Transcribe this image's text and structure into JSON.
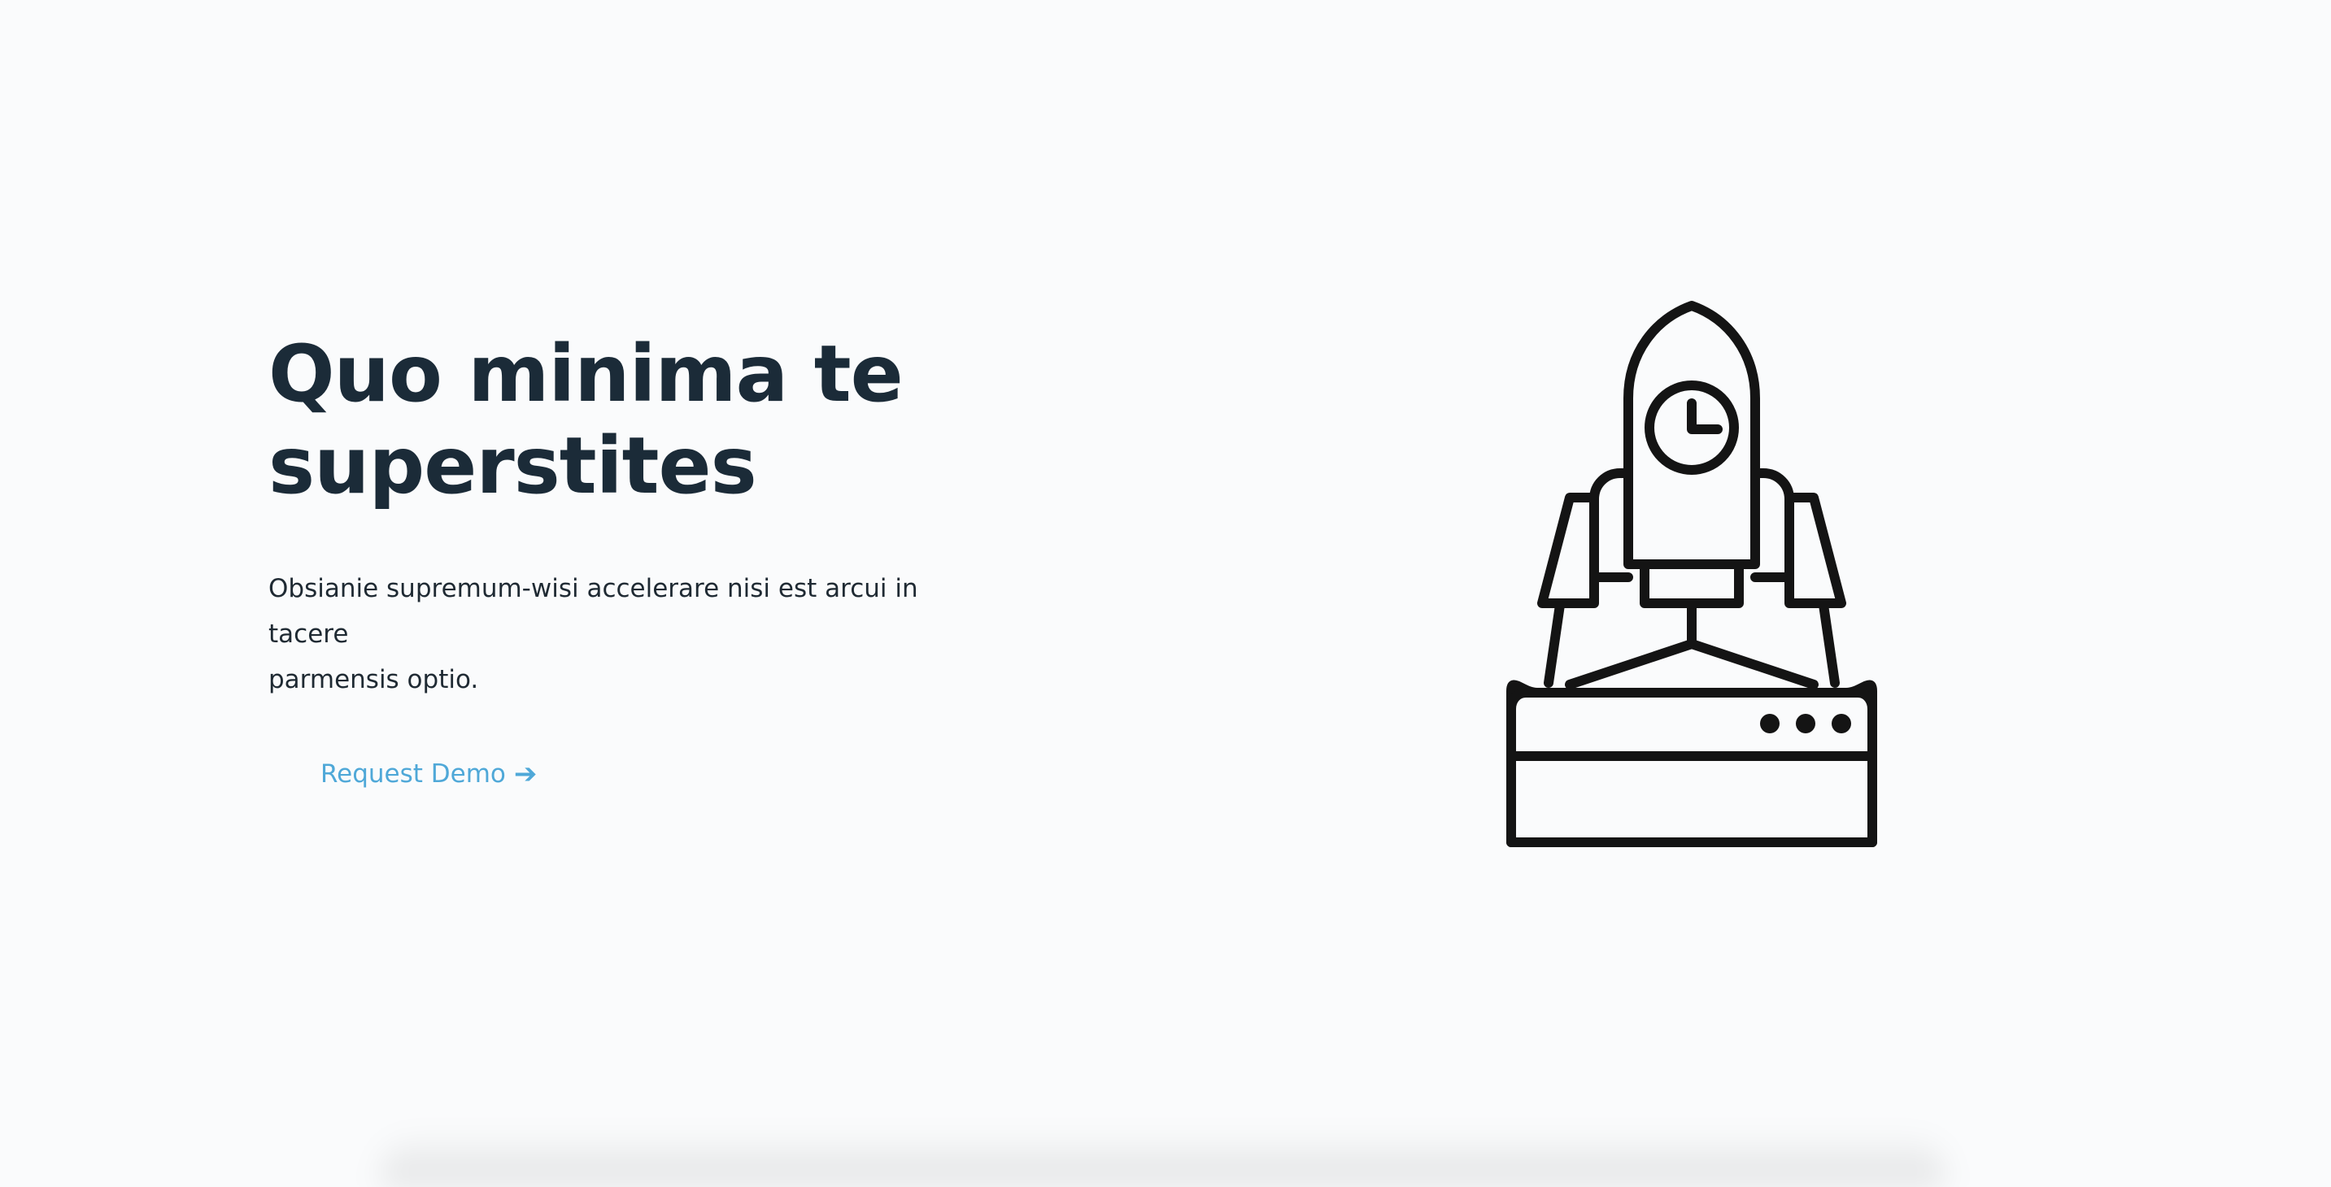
{
  "hero": {
    "title_line1": "Quo minima te",
    "title_line2": "superstites",
    "subtitle_line1": "Obsianie supremum-wisi accelerare nisi est arcui in tacere",
    "subtitle_line2": "parmensis optio.",
    "cta_label": "Request Demo",
    "cta_arrow": "➔",
    "illustration_icon": "rocket-launch-server-icon"
  },
  "colors": {
    "background": "#fafbfc",
    "heading": "#1b2b38",
    "text": "#1f2a33",
    "accent": "#4fa8d8",
    "icon_stroke": "#141414"
  }
}
